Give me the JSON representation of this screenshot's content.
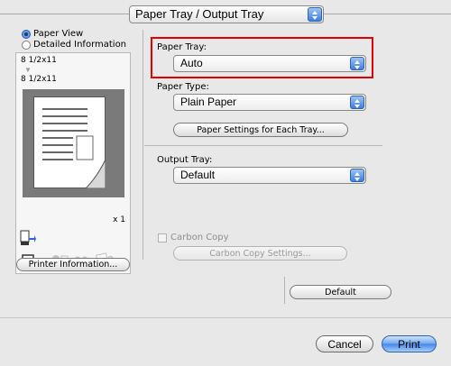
{
  "top_popup": {
    "label": "Paper Tray / Output Tray",
    "icon": "popup-arrows-icon"
  },
  "left": {
    "radio_paper_view": "Paper View",
    "radio_detailed_info": "Detailed Information",
    "paper_size_1": "8 1/2x11",
    "paper_size_2": "8 1/2x11",
    "copies": "x 1",
    "printer_info_button": "Printer Information..."
  },
  "right": {
    "paper_tray_label": "Paper Tray:",
    "paper_tray_value": "Auto",
    "paper_type_label": "Paper Type:",
    "paper_type_value": "Plain Paper",
    "paper_settings_button": "Paper Settings for Each Tray...",
    "output_tray_label": "Output Tray:",
    "output_tray_value": "Default",
    "carbon_copy_label": "Carbon Copy",
    "carbon_copy_settings_button": "Carbon Copy Settings...",
    "default_button": "Default"
  },
  "footer": {
    "cancel_button": "Cancel",
    "print_button": "Print"
  },
  "colors": {
    "highlight_border": "#e00000",
    "accent_blue": "#3f86ea"
  }
}
